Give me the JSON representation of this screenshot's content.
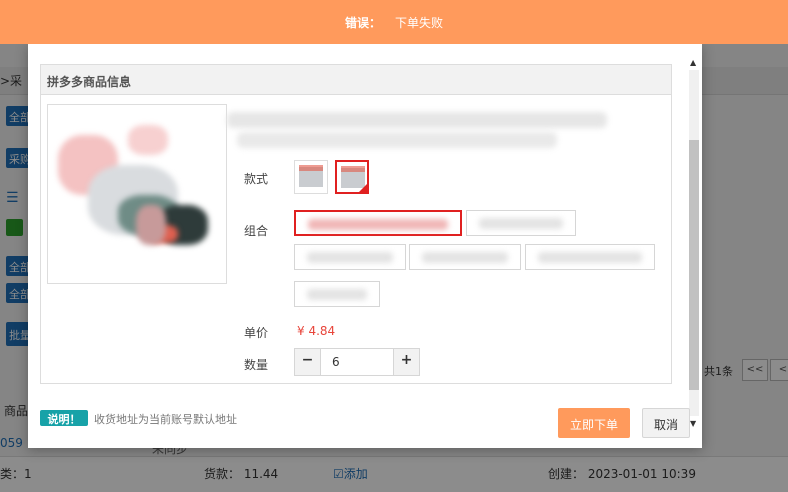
{
  "banner": {
    "label": "错误：",
    "message": "下单失败"
  },
  "background": {
    "breadcrumb": ">采",
    "buttons": [
      "全部",
      "采购",
      "全部",
      "全部",
      "批量"
    ],
    "pagination_total": "共1条",
    "first_page": "<<",
    "prev_page": "<",
    "column_header": "商品",
    "row_id": "059",
    "row_status": "未同步",
    "row_category": "类：1",
    "row_goods": "货款： 11.44",
    "row_add": "添加",
    "row_created": "创建： 2023-01-01 10:39"
  },
  "dialog": {
    "panel_title": "拼多多商品信息",
    "style_label": "款式",
    "combo_label": "组合",
    "price_label": "单价",
    "price_value": "¥ 4.84",
    "quantity_label": "数量",
    "quantity_value": "6",
    "minus": "−",
    "plus": "+",
    "note_badge": "说明！",
    "note_text": "收货地址为当前账号默认地址",
    "order_button": "立即下单",
    "cancel_button": "取消"
  },
  "colors": {
    "banner": "#ff9a5c",
    "price": "#e8443a",
    "selected_border": "#e02020",
    "note_badge": "#17a2a8"
  }
}
